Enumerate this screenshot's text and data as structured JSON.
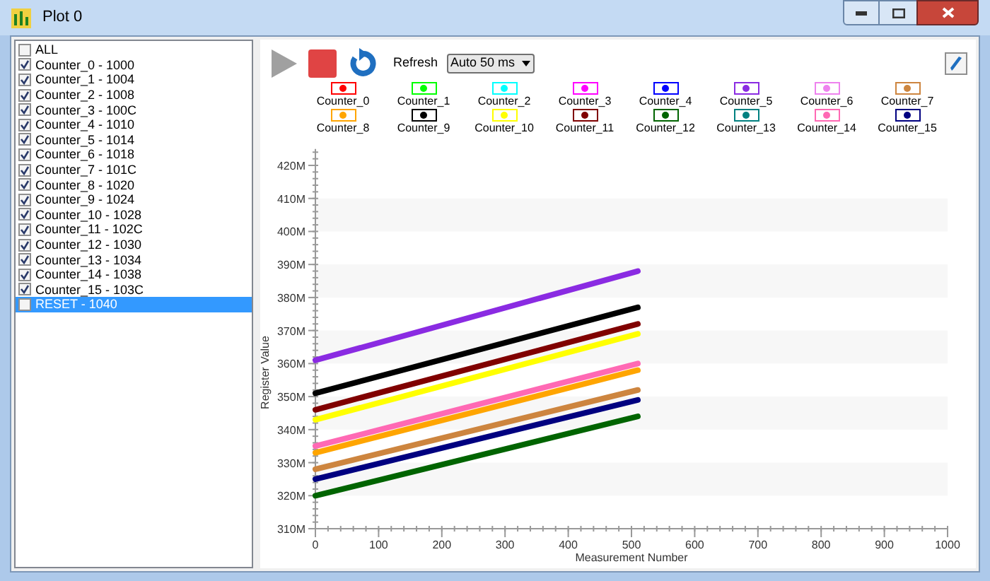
{
  "window": {
    "title": "Plot 0"
  },
  "counter_list": [
    {
      "label": "ALL",
      "checked": false,
      "selected": false
    },
    {
      "label": "Counter_0 - 1000",
      "checked": true,
      "selected": false
    },
    {
      "label": "Counter_1 - 1004",
      "checked": true,
      "selected": false
    },
    {
      "label": "Counter_2 - 1008",
      "checked": true,
      "selected": false
    },
    {
      "label": "Counter_3 - 100C",
      "checked": true,
      "selected": false
    },
    {
      "label": "Counter_4 - 1010",
      "checked": true,
      "selected": false
    },
    {
      "label": "Counter_5 - 1014",
      "checked": true,
      "selected": false
    },
    {
      "label": "Counter_6 - 1018",
      "checked": true,
      "selected": false
    },
    {
      "label": "Counter_7 - 101C",
      "checked": true,
      "selected": false
    },
    {
      "label": "Counter_8 - 1020",
      "checked": true,
      "selected": false
    },
    {
      "label": "Counter_9 - 1024",
      "checked": true,
      "selected": false
    },
    {
      "label": "Counter_10 - 1028",
      "checked": true,
      "selected": false
    },
    {
      "label": "Counter_11 - 102C",
      "checked": true,
      "selected": false
    },
    {
      "label": "Counter_12 - 1030",
      "checked": true,
      "selected": false
    },
    {
      "label": "Counter_13 - 1034",
      "checked": true,
      "selected": false
    },
    {
      "label": "Counter_14 - 1038",
      "checked": true,
      "selected": false
    },
    {
      "label": "Counter_15 - 103C",
      "checked": true,
      "selected": false
    },
    {
      "label": "RESET - 1040",
      "checked": false,
      "selected": true
    }
  ],
  "toolbar": {
    "refresh_label": "Refresh",
    "refresh_value": "Auto 50 ms"
  },
  "legend": [
    {
      "name": "Counter_0",
      "color": "#ff0000"
    },
    {
      "name": "Counter_1",
      "color": "#00ff00"
    },
    {
      "name": "Counter_2",
      "color": "#00ffff"
    },
    {
      "name": "Counter_3",
      "color": "#ff00ff"
    },
    {
      "name": "Counter_4",
      "color": "#0000ff"
    },
    {
      "name": "Counter_5",
      "color": "#8a2be2"
    },
    {
      "name": "Counter_6",
      "color": "#ee82ee"
    },
    {
      "name": "Counter_7",
      "color": "#cd853f"
    },
    {
      "name": "Counter_8",
      "color": "#ffa500"
    },
    {
      "name": "Counter_9",
      "color": "#000000"
    },
    {
      "name": "Counter_10",
      "color": "#ffff00"
    },
    {
      "name": "Counter_11",
      "color": "#800000"
    },
    {
      "name": "Counter_12",
      "color": "#006400"
    },
    {
      "name": "Counter_13",
      "color": "#008080"
    },
    {
      "name": "Counter_14",
      "color": "#ff69b4"
    },
    {
      "name": "Counter_15",
      "color": "#000080"
    }
  ],
  "chart": {
    "chart_data": {
      "type": "line",
      "xlabel": "Measurement Number",
      "ylabel": "Register Value",
      "x": [
        0,
        510
      ],
      "xlim": [
        0,
        1000
      ],
      "ylim": [
        310,
        425
      ],
      "xticks": [
        0,
        100,
        200,
        300,
        400,
        500,
        600,
        700,
        800,
        900,
        1000
      ],
      "yticks": [
        {
          "value": 310,
          "label": "310M"
        },
        {
          "value": 320,
          "label": "320M"
        },
        {
          "value": 330,
          "label": "330M"
        },
        {
          "value": 340,
          "label": "340M"
        },
        {
          "value": 350,
          "label": "350M"
        },
        {
          "value": 360,
          "label": "360M"
        },
        {
          "value": 370,
          "label": "370M"
        },
        {
          "value": 380,
          "label": "380M"
        },
        {
          "value": 390,
          "label": "390M"
        },
        {
          "value": 400,
          "label": "400M"
        },
        {
          "value": 410,
          "label": "410M"
        },
        {
          "value": 420,
          "label": "420M"
        }
      ],
      "series": [
        {
          "color": "#8a2be2",
          "values": [
            361,
            388
          ]
        },
        {
          "color": "#000000",
          "values": [
            351,
            377
          ]
        },
        {
          "color": "#800000",
          "values": [
            346,
            372
          ]
        },
        {
          "color": "#ffff00",
          "values": [
            343,
            369
          ]
        },
        {
          "color": "#ff69b4",
          "values": [
            335,
            360
          ]
        },
        {
          "color": "#ffa500",
          "values": [
            333,
            358
          ]
        },
        {
          "color": "#cd853f",
          "values": [
            328,
            352
          ]
        },
        {
          "color": "#000080",
          "values": [
            325,
            349
          ]
        },
        {
          "color": "#006400",
          "values": [
            320,
            344
          ]
        }
      ]
    }
  }
}
